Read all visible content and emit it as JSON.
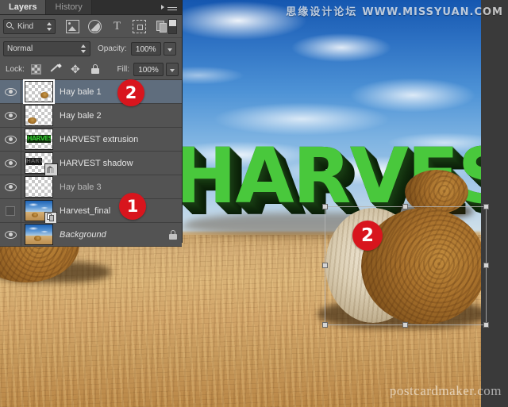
{
  "app": {
    "name": "Adobe Photoshop Layers Panel"
  },
  "panel": {
    "tabs": [
      {
        "label": "Layers",
        "active": true
      },
      {
        "label": "History",
        "active": false
      }
    ],
    "menu_icon": "panel-menu-icon",
    "filter": {
      "kind_label": "Kind",
      "search_icon": "magnifier-icon",
      "stepper_icon": "up-down-arrows-icon",
      "icons": [
        {
          "name": "filter-pixel-layers-icon",
          "title": "Pixel layers"
        },
        {
          "name": "filter-adjustment-layers-icon",
          "title": "Adjustment layers"
        },
        {
          "name": "filter-type-layers-icon",
          "title": "Type layers",
          "glyph": "T"
        },
        {
          "name": "filter-shape-layers-icon",
          "title": "Shape layers"
        },
        {
          "name": "filter-smart-object-layers-icon",
          "title": "Smart objects"
        }
      ],
      "toggle_name": "filter-enable-toggle"
    },
    "blend": {
      "mode": "Normal",
      "opacity_label": "Opacity:",
      "opacity_value": "100%"
    },
    "lock": {
      "label": "Lock:",
      "icons": [
        {
          "name": "lock-transparent-pixels-icon"
        },
        {
          "name": "lock-image-pixels-icon"
        },
        {
          "name": "lock-position-icon"
        },
        {
          "name": "lock-all-icon"
        }
      ],
      "fill_label": "Fill:",
      "fill_value": "100%"
    },
    "layers": [
      {
        "name": "Hay bale 1",
        "visible": true,
        "selected": true,
        "thumb": "transparent-bale-small",
        "locked": false,
        "italic": false
      },
      {
        "name": "Hay bale 2",
        "visible": true,
        "selected": false,
        "thumb": "transparent-bale-left",
        "locked": false,
        "italic": false
      },
      {
        "name": "HARVEST extrusion",
        "visible": true,
        "selected": false,
        "thumb": "green-harvest-text",
        "locked": false,
        "italic": false
      },
      {
        "name": "HARVEST shadow",
        "visible": true,
        "selected": false,
        "thumb": "dark-harvest-text",
        "badge": "3d-badge",
        "locked": false,
        "italic": false
      },
      {
        "name": "Hay bale 3",
        "visible": true,
        "selected": false,
        "thumb": "transparent-empty",
        "locked": false,
        "italic": false
      },
      {
        "name": "Harvest_final",
        "visible": false,
        "selected": false,
        "thumb": "photo-field",
        "badge": "smart-object-badge",
        "locked": false,
        "italic": false
      },
      {
        "name": "Background",
        "visible": true,
        "selected": false,
        "thumb": "photo-field",
        "locked": true,
        "italic": true
      }
    ]
  },
  "callouts": [
    {
      "id": "a",
      "number": "2"
    },
    {
      "id": "b",
      "number": "1"
    },
    {
      "id": "c",
      "number": "2"
    }
  ],
  "canvas": {
    "artwork_text": "HARVEST",
    "watermark_top_cn": "思缘设计论坛",
    "watermark_top_url": "WWW.MISSYUAN.COM",
    "watermark_bottom": "postcardmaker.com",
    "transform_box": "free-transform-bounding-box"
  },
  "colors": {
    "panel_bg": "#535353",
    "panel_dark": "#2f2f2f",
    "selected_row": "#5f6d7d",
    "callout_red": "#d8151d",
    "text_green": "#49c83c",
    "text_green_dark": "#14300f"
  }
}
